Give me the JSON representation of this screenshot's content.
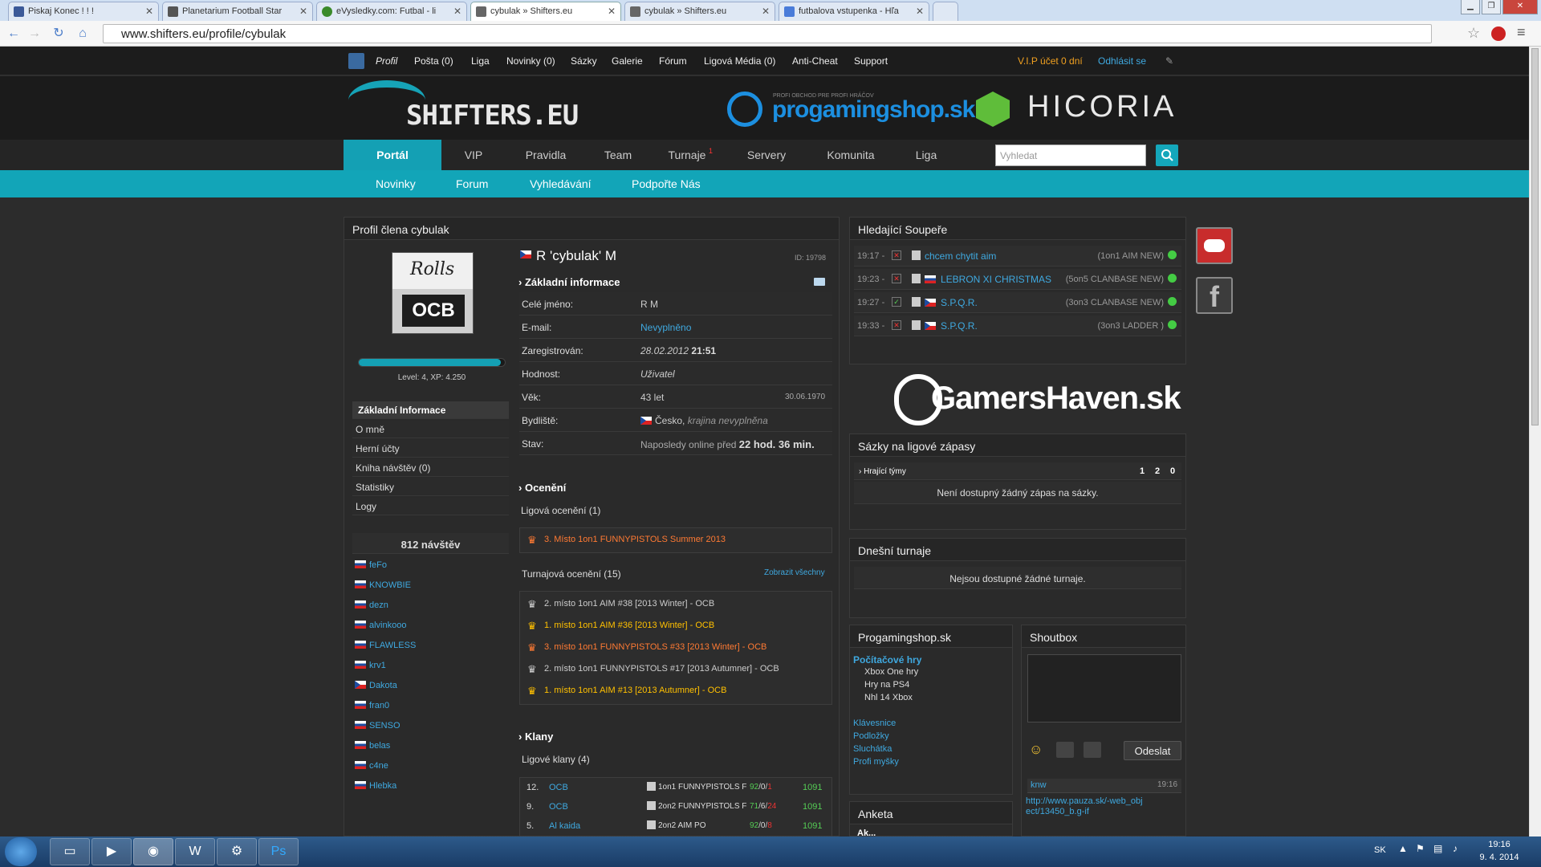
{
  "browser": {
    "tabs": [
      {
        "label": "Piskaj Konec ! ! !"
      },
      {
        "label": "Planetarium Football Star"
      },
      {
        "label": "eVysledky.com: Futbal - li"
      },
      {
        "label": "cybulak » Shifters.eu"
      },
      {
        "label": "cybulak » Shifters.eu"
      },
      {
        "label": "futbalova vstupenka - Hľa"
      }
    ],
    "url": "www.shifters.eu/profile/cybulak"
  },
  "topbar": {
    "items": [
      "Profil",
      "Pošta (0)",
      "Liga",
      "Novinky (0)",
      "Sázky",
      "Galerie",
      "Fórum",
      "Ligová Média (0)",
      "Anti-Cheat",
      "Support"
    ],
    "vip": "V.I.P účet 0 dní",
    "logout": "Odhlásit se"
  },
  "header": {
    "logo": "SHIFTERS.EU",
    "sponsor1_small": "PROFI OBCHOD PRE PROFI HRÁČOV",
    "sponsor1": "progamingshop.sk",
    "sponsor2": "HICORIA"
  },
  "mainnav": [
    "Portál",
    "VIP",
    "Pravidla",
    "Team",
    "Turnaje",
    "Servery",
    "Komunita",
    "Liga"
  ],
  "turnaje_badge": "1",
  "search": {
    "placeholder": "Vyhledat"
  },
  "subnav": [
    "Novinky",
    "Forum",
    "Vyhledávání",
    "Podpořte Nás"
  ],
  "profile": {
    "panel_title": "Profil člena cybulak",
    "avatar_text_top": "Rolls",
    "avatar_text_bottom": "OCB",
    "level_text": "Level: 4, XP: 4.250",
    "xp_progress": 0.97,
    "name": "R 'cybulak' M",
    "id": "ID: 19798",
    "menu": [
      "Základní Informace",
      "O mně",
      "Herní účty",
      "Kniha návštěv (0)",
      "Statistiky",
      "Logy"
    ],
    "visits": "812 návštěv",
    "visitors": [
      {
        "name": "feFo",
        "flag": "sk"
      },
      {
        "name": "KNOWBIE",
        "flag": "sk"
      },
      {
        "name": "dezn",
        "flag": "sk"
      },
      {
        "name": "alvinkooo",
        "flag": "sk"
      },
      {
        "name": "FLAWLESS",
        "flag": "sk"
      },
      {
        "name": "krv1",
        "flag": "sk"
      },
      {
        "name": "Dakota",
        "flag": "cz"
      },
      {
        "name": "fran0",
        "flag": "sk"
      },
      {
        "name": "SENSO",
        "flag": "sk"
      },
      {
        "name": "belas",
        "flag": "sk"
      },
      {
        "name": "c4ne",
        "flag": "sk"
      },
      {
        "name": "Hlebka",
        "flag": "sk"
      }
    ],
    "basic_title": "Základní informace",
    "fields": [
      {
        "label": "Celé jméno:",
        "value": "R M"
      },
      {
        "label": "E-mail:",
        "value": "Nevyplněno"
      },
      {
        "label": "Zaregistrován:",
        "value": "28.02.2012",
        "value2": "21:51"
      },
      {
        "label": "Hodnost:",
        "value": "Uživatel"
      },
      {
        "label": "Věk:",
        "value": "43 let",
        "extra": "30.06.1970"
      },
      {
        "label": "Bydliště:",
        "value": "Česko,",
        "value2": "krajina nevyplněna"
      },
      {
        "label": "Stav:",
        "value": "Naposledy online před",
        "value2": "22 hod. 36 min."
      }
    ],
    "awards_title": "Ocenění",
    "league_awards_label": "Ligová ocenění (1)",
    "league_awards": [
      {
        "text": "3. Místo 1on1 FUNNYPISTOLS Summer 2013",
        "tier": "bronze"
      }
    ],
    "tournament_awards_label": "Turnajová ocenění (15)",
    "show_all": "Zobrazit všechny",
    "tournament_awards": [
      {
        "text": "2. místo 1on1 AIM #38 [2013 Winter] - OCB",
        "tier": "silver"
      },
      {
        "text": "1. místo 1on1 AIM #36 [2013 Winter] - OCB",
        "tier": "gold"
      },
      {
        "text": "3. místo 1on1 FUNNYPISTOLS #33 [2013 Winter] - OCB",
        "tier": "bronze"
      },
      {
        "text": "2. místo 1on1 FUNNYPISTOLS #17 [2013 Autumner] - OCB",
        "tier": "silver"
      },
      {
        "text": "1. místo 1on1 AIM #13 [2013 Autumner] - OCB",
        "tier": "gold"
      }
    ],
    "clans_title": "Klany",
    "league_clans_label": "Ligové klany (4)",
    "clans": [
      {
        "rank": "12.",
        "name": "OCB",
        "league": "1on1 FUNNYPISTOLS F",
        "w": "92",
        "d": "0",
        "l": "1",
        "pts": "1091"
      },
      {
        "rank": "9.",
        "name": "OCB",
        "league": "2on2 FUNNYPISTOLS F",
        "w": "71",
        "d": "6",
        "l": "24",
        "pts": "1091"
      },
      {
        "rank": "5.",
        "name": "Al kaida",
        "league": "2on2 AIM PO",
        "w": "92",
        "d": "0",
        "l": "8",
        "pts": "1091"
      }
    ]
  },
  "opponents": {
    "title": "Hledající Soupeře",
    "rows": [
      {
        "time": "19:17 -",
        "mark": "✕",
        "flag": "",
        "name": "chcem chytit aim",
        "type": "(1on1 AIM NEW)"
      },
      {
        "time": "19:23 -",
        "mark": "✕",
        "flag": "sk",
        "name": "LEBRON XI CHRISTMAS",
        "type": "(5on5 CLANBASE NEW)"
      },
      {
        "time": "19:27 -",
        "mark": "✓",
        "flag": "cz",
        "name": "S.P.Q.R.",
        "type": "(3on3 CLANBASE NEW)"
      },
      {
        "time": "19:33 -",
        "mark": "✕",
        "flag": "cz",
        "name": "S.P.Q.R.",
        "type": "(3on3 LADDER )"
      }
    ]
  },
  "gamershaven": "GamersHaven.sk",
  "bets": {
    "title": "Sázky na ligové zápasy",
    "teams_label": "Hrající týmy",
    "cols": [
      "1",
      "2",
      "0"
    ],
    "empty": "Není dostupný žádný zápas na sázky."
  },
  "today_tournaments": {
    "title": "Dnešní turnaje",
    "empty": "Nejsou dostupné žádné turnaje."
  },
  "progamingshop": {
    "title": "Progamingshop.sk",
    "category": "Počítačové hry",
    "subitems": [
      "Xbox One hry",
      "Hry na PS4",
      "Nhl 14 Xbox"
    ],
    "links": [
      "Klávesnice",
      "Podložky",
      "Sluchátka",
      "Profi myšky"
    ]
  },
  "anketa": {
    "title": "Anketa",
    "question": "Ak..."
  },
  "shoutbox": {
    "title": "Shoutbox",
    "send": "Odeslat",
    "author": "knw",
    "time": "19:16",
    "message": "http://www.pauza.sk/-web_object/13450_b.g-if"
  },
  "taskbar": {
    "lang": "SK",
    "time": "19:16",
    "date": "9. 4. 2014"
  },
  "colors": {
    "accent": "#14a0b4",
    "link": "#3fa9e0",
    "gold": "#ffc000",
    "bronze": "#ff7a33"
  }
}
